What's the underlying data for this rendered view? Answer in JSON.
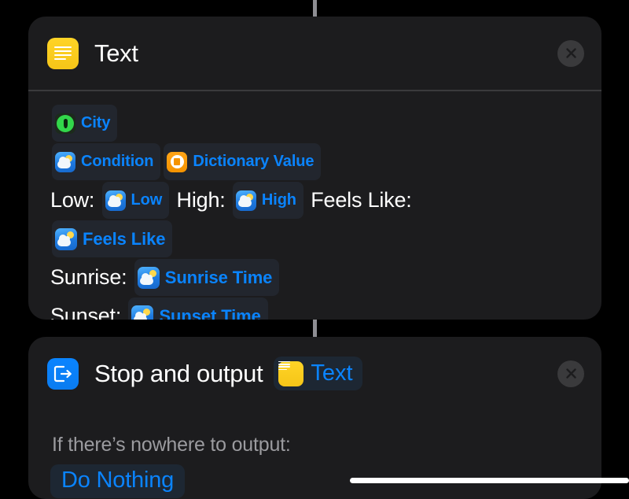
{
  "app": {
    "name": "Shortcuts Editor"
  },
  "connectors": {
    "line_color": "#8e8e93"
  },
  "colors": {
    "page_background": "#000000",
    "card_background": "#1c1c1e",
    "accent_blue": "#0a84ff",
    "token_background": "#22262e",
    "divider": "#3a3a3c",
    "secondary_text": "#9b9b9f",
    "icon_yellow": "#ffd426",
    "icon_green": "#32d74b",
    "icon_orange": "#ffa417"
  },
  "cards": [
    {
      "id": "text-action",
      "icon": "text-lines-icon",
      "title": "Text",
      "close_label": "close-icon",
      "content_lines": [
        {
          "parts": [
            {
              "kind": "token",
              "label": "City",
              "icon": "location-icon",
              "size": "small"
            }
          ]
        },
        {
          "parts": [
            {
              "kind": "token",
              "label": "Condition",
              "icon": "weather-icon",
              "size": "small"
            },
            {
              "kind": "token",
              "label": "Dictionary Value",
              "icon": "dictionary-icon",
              "size": "small"
            }
          ]
        },
        {
          "parts": [
            {
              "kind": "text",
              "value": "Low: "
            },
            {
              "kind": "token",
              "label": "Low",
              "icon": "weather-icon",
              "size": "small"
            },
            {
              "kind": "text",
              "value": " High: "
            },
            {
              "kind": "token",
              "label": "High",
              "icon": "weather-icon",
              "size": "small"
            },
            {
              "kind": "text",
              "value": " Feels Like:"
            }
          ]
        },
        {
          "parts": [
            {
              "kind": "token",
              "label": "Feels Like",
              "icon": "weather-icon",
              "size": "big"
            }
          ]
        },
        {
          "parts": [
            {
              "kind": "text",
              "value": "Sunrise: "
            },
            {
              "kind": "token",
              "label": "Sunrise Time",
              "icon": "weather-icon",
              "size": "big"
            }
          ]
        },
        {
          "parts": [
            {
              "kind": "text",
              "value": "Sunset: "
            },
            {
              "kind": "token",
              "label": "Sunset Time",
              "icon": "weather-icon",
              "size": "big"
            }
          ]
        }
      ]
    },
    {
      "id": "stop-and-output",
      "icon": "exit-box-icon",
      "title": "Stop and output",
      "title_token": {
        "label": "Text",
        "icon": "text-lines-icon"
      },
      "close_label": "close-icon",
      "fallback_label": "If there’s nowhere to output:",
      "fallback_value": "Do Nothing"
    }
  ],
  "system": {
    "home_indicator": "home-indicator"
  }
}
